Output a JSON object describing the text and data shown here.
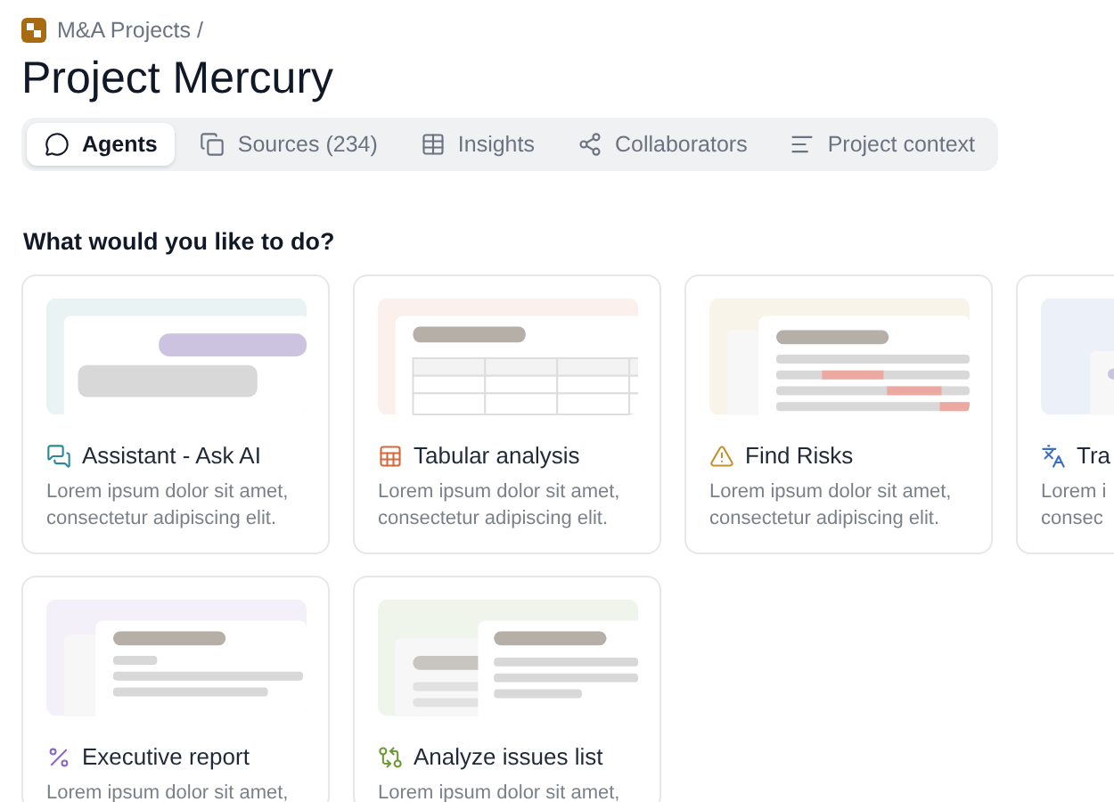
{
  "breadcrumb": {
    "label": "M&A Projects /"
  },
  "title": "Project Mercury",
  "tabs": [
    {
      "kind": "agents",
      "label": "Agents",
      "selected": true
    },
    {
      "kind": "sources",
      "label": "Sources (234)",
      "selected": false
    },
    {
      "kind": "insights",
      "label": "Insights",
      "selected": false
    },
    {
      "kind": "collaborators",
      "label": "Collaborators",
      "selected": false
    },
    {
      "kind": "context",
      "label": "Project context",
      "selected": false
    }
  ],
  "section_heading": "What would you like to do?",
  "cards": [
    {
      "kind": "chat",
      "color": "#2a8a94",
      "title": "Assistant - Ask AI",
      "description": [
        "Lorem ipsum dolor sit amet,",
        "consectetur adipiscing elit."
      ]
    },
    {
      "kind": "table",
      "color": "#d4683a",
      "title": "Tabular analysis",
      "description": [
        "Lorem ipsum dolor sit amet,",
        "consectetur adipiscing elit."
      ]
    },
    {
      "kind": "risks",
      "color": "#c0922f",
      "title": "Find Risks",
      "description": [
        "Lorem ipsum dolor sit amet,",
        "consectetur adipiscing elit."
      ]
    },
    {
      "kind": "translate",
      "color": "#3b6fc4",
      "title": "Tra",
      "description": [
        "Lorem i",
        "consec"
      ]
    },
    {
      "kind": "report",
      "color": "#8a6ac8",
      "title": "Executive report",
      "description": [
        "Lorem ipsum dolor sit amet,"
      ]
    },
    {
      "kind": "issues",
      "color": "#6f9a3a",
      "title": "Analyze issues list",
      "description": [
        "Lorem ipsum dolor sit amet,"
      ]
    }
  ]
}
